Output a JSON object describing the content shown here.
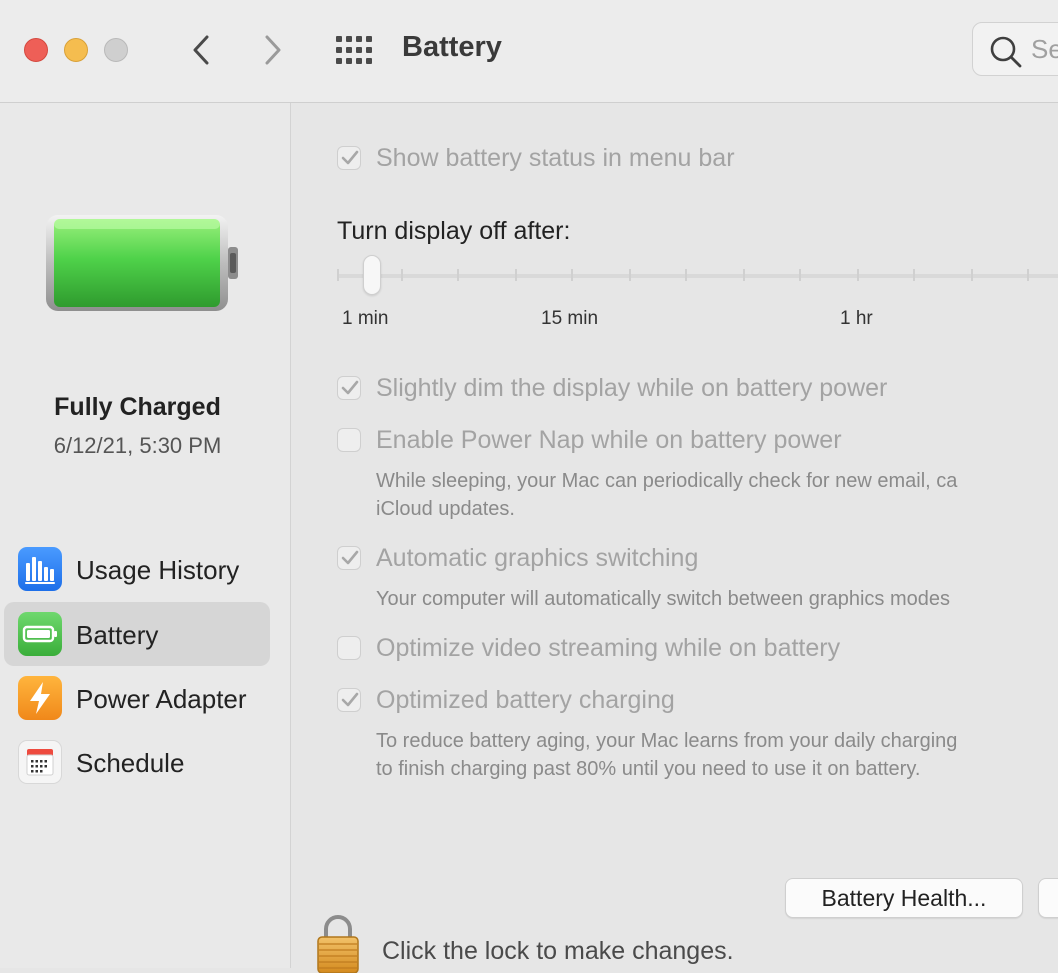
{
  "window": {
    "title": "Battery"
  },
  "search": {
    "placeholder": "Search"
  },
  "sidebar": {
    "status_title": "Fully Charged",
    "status_date": "6/12/21, 5:30 PM",
    "items": [
      {
        "label": "Usage History",
        "icon": "usage-history-icon",
        "color": "#2f7cf6"
      },
      {
        "label": "Battery",
        "icon": "battery-icon",
        "color": "#56c15a",
        "selected": true
      },
      {
        "label": "Power Adapter",
        "icon": "power-adapter-icon",
        "color": "#f7a02a"
      },
      {
        "label": "Schedule",
        "icon": "schedule-icon",
        "color": "#ee4b3f"
      }
    ]
  },
  "main": {
    "show_status": {
      "label": "Show battery status in menu bar",
      "checked": true
    },
    "display_off_label": "Turn display off after:",
    "slider": {
      "ticks": [
        "1 min",
        "15 min",
        "1 hr"
      ],
      "value": "1 min"
    },
    "options": [
      {
        "label": "Slightly dim the display while on battery power",
        "checked": true,
        "desc": []
      },
      {
        "label": "Enable Power Nap while on battery power",
        "checked": false,
        "desc": [
          "While sleeping, your Mac can periodically check for new email, ca",
          "iCloud updates."
        ]
      },
      {
        "label": "Automatic graphics switching",
        "checked": true,
        "desc": [
          "Your computer will automatically switch between graphics modes"
        ]
      },
      {
        "label": "Optimize video streaming while on battery",
        "checked": false,
        "desc": []
      },
      {
        "label": "Optimized battery charging",
        "checked": true,
        "desc": [
          "To reduce battery aging, your Mac learns from your daily charging",
          "to finish charging past 80% until you need to use it on battery."
        ]
      }
    ],
    "battery_health_button": "Battery Health...",
    "lock_text": "Click the lock to make changes."
  },
  "colors": {
    "close": "#ee5f57",
    "minimize": "#f5bd4f",
    "zoom": "#cfcfcf",
    "battery_green": "#4fd24a"
  }
}
